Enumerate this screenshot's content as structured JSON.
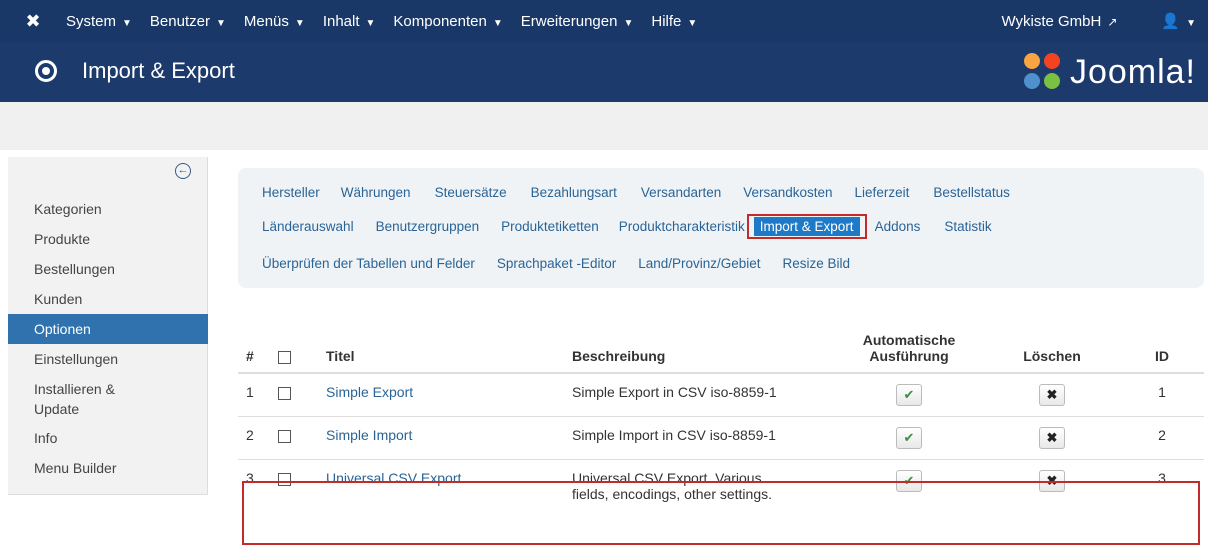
{
  "topnav": {
    "menus": [
      "System",
      "Benutzer",
      "Menüs",
      "Inhalt",
      "Komponenten",
      "Erweiterungen",
      "Hilfe"
    ],
    "site_label": "Wykiste GmbH",
    "user_icon": "user-icon"
  },
  "header": {
    "page_title": "Import & Export",
    "brand_text": "Joomla!"
  },
  "sidebar": {
    "items": [
      "Kategorien",
      "Produkte",
      "Bestellungen",
      "Kunden",
      "Optionen",
      "Einstellungen",
      "Installieren & Update",
      "Info",
      "Menu Builder"
    ],
    "active": "Optionen"
  },
  "tabs": {
    "row1": [
      "Hersteller",
      "Währungen",
      "Steuersätze",
      "Bezahlungsart",
      "Versandarten",
      "Versandkosten",
      "Lieferzeit",
      "Bestellstatus"
    ],
    "row2": [
      "Länderauswahl",
      "Benutzergruppen",
      "Produktetiketten",
      "Produktcharakteristik",
      "Import & Export",
      "Addons",
      "Statistik"
    ],
    "row3": [
      "Überprüfen der Tabellen und Felder",
      "Sprachpaket -Editor",
      "Land/Provinz/Gebiet",
      "Resize Bild"
    ],
    "active": "Import & Export"
  },
  "table": {
    "headers": {
      "num": "#",
      "title": "Titel",
      "description": "Beschreibung",
      "auto_line1": "Automatische",
      "auto_line2": "Ausführung",
      "delete": "Löschen",
      "id": "ID"
    },
    "rows": [
      {
        "num": "1",
        "title": "Simple Export",
        "description": "Simple Export in CSV iso-8859-1",
        "id": "1"
      },
      {
        "num": "2",
        "title": "Simple Import",
        "description": "Simple Import in CSV iso-8859-1",
        "id": "2"
      },
      {
        "num": "3",
        "title": "Universal CSV Export",
        "description_line1": "Universal CSV Export. Various",
        "description_line2": "fields, encodings, other settings.",
        "id": "3"
      }
    ]
  }
}
